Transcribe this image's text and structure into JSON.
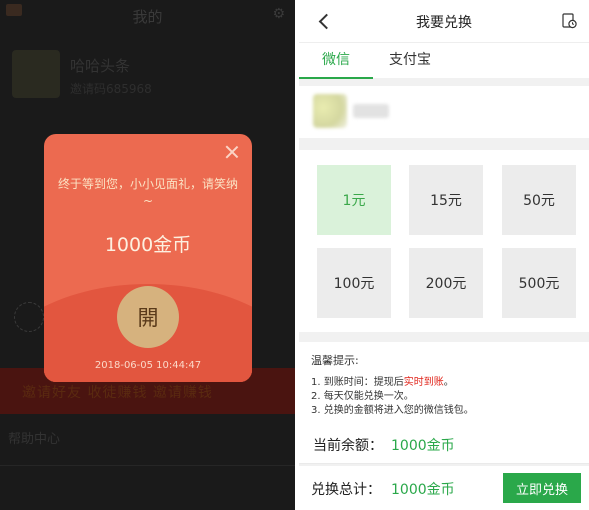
{
  "left": {
    "background": {
      "title": "我的",
      "name": "哈哈头条",
      "id": "邀请码685968",
      "banner": "邀请好友 收徒赚钱 邀请赚钱",
      "row": "帮助中心"
    },
    "popup": {
      "message": "终于等到您，小小见面礼，请笑纳~",
      "amount": "1000金币",
      "open_label": "開",
      "timestamp": "2018-06-05 10:44:47"
    }
  },
  "right": {
    "title": "我要兑换",
    "tabs": [
      {
        "label": "微信",
        "active": true
      },
      {
        "label": "支付宝",
        "active": false
      }
    ],
    "amounts": [
      {
        "label": "1元",
        "selected": true
      },
      {
        "label": "15元",
        "selected": false
      },
      {
        "label": "50元",
        "selected": false
      },
      {
        "label": "100元",
        "selected": false
      },
      {
        "label": "200元",
        "selected": false
      },
      {
        "label": "500元",
        "selected": false
      }
    ],
    "tips": {
      "title": "温馨提示:",
      "items": [
        {
          "prefix": "1. 到账时间：提现后",
          "highlight": "实时到账",
          "suffix": "。"
        },
        {
          "prefix": "2. 每天仅能兑换一次。",
          "highlight": "",
          "suffix": ""
        },
        {
          "prefix": "3. 兑换的金额将进入您的微信钱包。",
          "highlight": "",
          "suffix": ""
        }
      ]
    },
    "balance": {
      "label": "当前余额：",
      "value": "1000金币"
    },
    "total": {
      "label": "兑换总计：",
      "value": "1000金币"
    },
    "exchange_button": "立即兑换"
  },
  "colors": {
    "accent_green": "#2aa84a",
    "popup_red": "#ec6a50",
    "tip_red": "#e0241a",
    "open_gold": "#d6b27e"
  },
  "icons": {
    "back": "chevron-left-icon",
    "history": "history-icon",
    "close": "close-icon"
  }
}
